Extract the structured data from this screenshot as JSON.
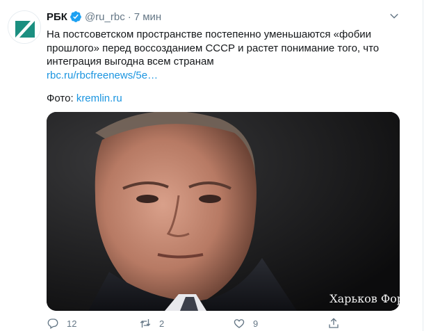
{
  "tweet": {
    "name": "РБК",
    "handle": "@ru_rbc",
    "separator": "·",
    "time": "7 мин",
    "text": "На постсоветском пространстве постепенно уменьшаются «фобии прошлого» перед воссозданием СССР и растет понимание того, что интеграция выгодна всем странам",
    "link": "rbc.ru/rbcfreenews/5e…",
    "photo_label": "Фото:",
    "photo_link": "kremlin.ru",
    "media": {
      "watermark": "Харьков Фор"
    },
    "actions": {
      "replies": "12",
      "retweets": "2",
      "likes": "9"
    },
    "icons": {
      "verified": "verified-badge-icon",
      "caret": "chevron-down-icon",
      "reply": "reply-icon",
      "retweet": "retweet-icon",
      "like": "heart-icon",
      "share": "share-icon"
    },
    "colors": {
      "link": "#1b95e0",
      "muted": "#657786",
      "avatar_green": "#1a8a7d"
    }
  }
}
